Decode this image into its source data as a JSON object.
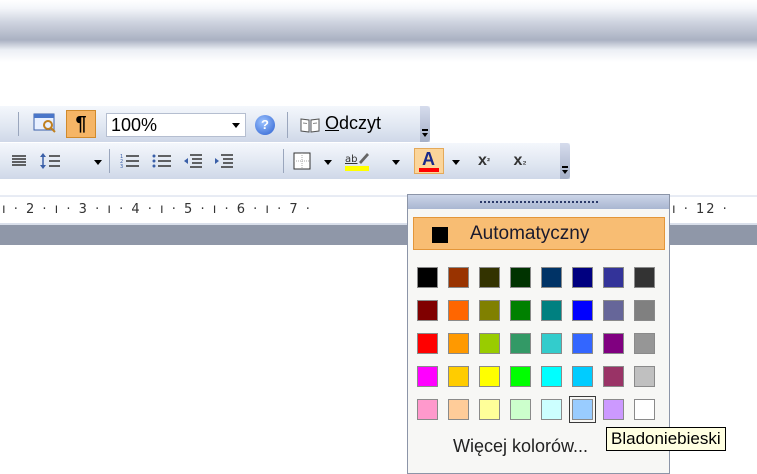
{
  "toolbar1": {
    "zoom_value": "100%",
    "pilcrow_glyph": "¶",
    "reading_mode_label": "Odczyt",
    "reading_mode_accesskey_char": "O",
    "reading_mode_rest": "dczyt"
  },
  "ruler": {
    "text": "ı · 2 · ı · 3 · ı · 4 · ı · 5 · ı · 6 · ı · 7 ·",
    "right_text": "ı · 12 ·"
  },
  "font_color_menu": {
    "automatic_label": "Automatyczny",
    "more_colors_label": "Więcej kolorów...",
    "palette": [
      [
        "#000000",
        "#993300",
        "#333300",
        "#003300",
        "#003366",
        "#000080",
        "#333399",
        "#333333"
      ],
      [
        "#800000",
        "#FF6600",
        "#808000",
        "#008000",
        "#008080",
        "#0000FF",
        "#666699",
        "#808080"
      ],
      [
        "#FF0000",
        "#FF9900",
        "#99CC00",
        "#339966",
        "#33CCCC",
        "#3366FF",
        "#800080",
        "#969696"
      ],
      [
        "#FF00FF",
        "#FFCC00",
        "#FFFF00",
        "#00FF00",
        "#00FFFF",
        "#00CCFF",
        "#993366",
        "#C0C0C0"
      ],
      [
        "#FF99CC",
        "#FFCC99",
        "#FFFF99",
        "#CCFFCC",
        "#CCFFFF",
        "#99CCFF",
        "#CC99FF",
        "#FFFFFF"
      ]
    ],
    "selected_color": "#99CCFF",
    "tooltip": "Bladoniebieski"
  },
  "icons": {
    "highlight_label": "ab",
    "font_color_glyph": "A",
    "superscript": "x²",
    "subscript": "x₂"
  }
}
